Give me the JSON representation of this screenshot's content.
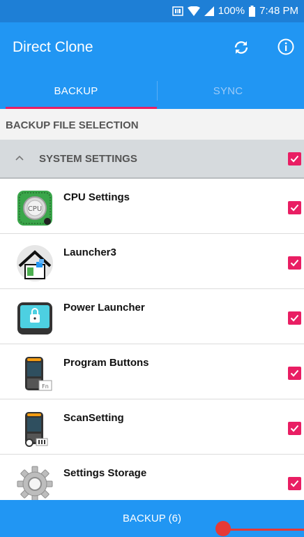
{
  "status_bar": {
    "battery": "100%",
    "time": "7:48 PM",
    "icons": [
      "scanner-icon",
      "wifi-icon",
      "signal-icon",
      "battery-icon"
    ]
  },
  "app_bar": {
    "title": "Direct Clone",
    "actions": [
      "sync-icon",
      "info-icon"
    ]
  },
  "tabs": [
    {
      "label": "BACKUP",
      "active": true
    },
    {
      "label": "SYNC",
      "active": false
    }
  ],
  "section_header": "BACKUP FILE SELECTION",
  "group": {
    "label": "SYSTEM SETTINGS",
    "checked": true,
    "icon": "chevron-up-icon"
  },
  "items": [
    {
      "name": "CPU Settings",
      "icon": "cpu-icon",
      "checked": true
    },
    {
      "name": "Launcher3",
      "icon": "house-icon",
      "checked": true
    },
    {
      "name": "Power Launcher",
      "icon": "lock-screen-icon",
      "checked": true
    },
    {
      "name": "Program Buttons",
      "icon": "handheld-fn-icon",
      "checked": true
    },
    {
      "name": "ScanSetting",
      "icon": "handheld-settings-icon",
      "checked": true
    },
    {
      "name": "Settings Storage",
      "icon": "gear-icon",
      "checked": true
    }
  ],
  "bottom_button": "BACKUP (6)",
  "colors": {
    "primary": "#2196f3",
    "status_bar": "#1e7fd6",
    "accent": "#e91e63",
    "group_bg": "#d6dadd"
  }
}
